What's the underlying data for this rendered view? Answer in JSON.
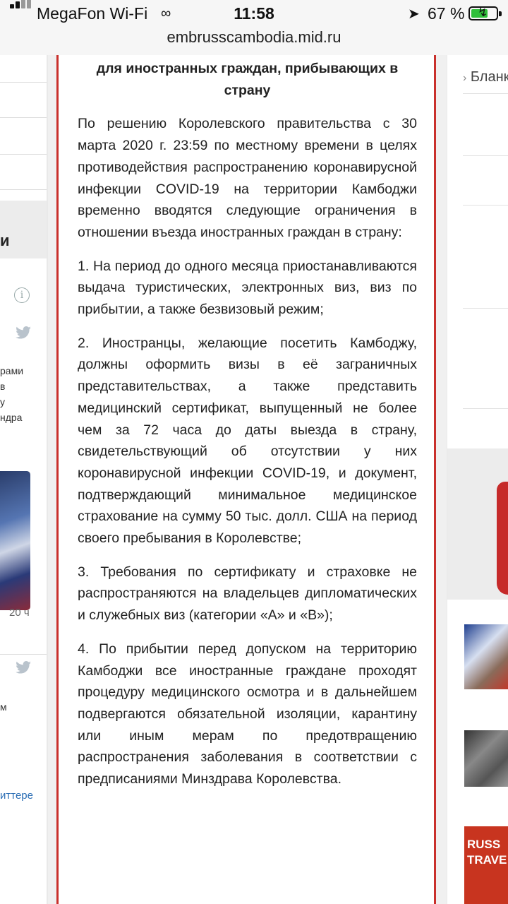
{
  "status_bar": {
    "carrier": "MegaFon Wi-Fi",
    "time": "11:58",
    "battery_percent": "67 %",
    "battery_level": 0.67,
    "battery_color": "#2fbf3a"
  },
  "browser": {
    "url": "embrusscambodia.mid.ru"
  },
  "article": {
    "heading": "для иностранных граждан, прибывающих в страну",
    "intro": "По решению Королевского правительства с 30 марта 2020 г. 23:59 по местному времени в целях противодействия распространению коронавирусной инфекции COVID-19 на территории Камбоджи временно вводятся следующие ограничения в отношении въезда иностранных граждан в страну:",
    "items": [
      "1. На период до одного месяца приостанавливаются выдача туристических, электронных виз, виз по прибытии, а также безвизовый режим;",
      "2. Иностранцы, желающие посетить Камбоджу, должны оформить визы в её заграничных представительствах, а также представить медицинский сертификат, выпущенный не более чем за 72 часа до даты выезда в страну, свидетельствующий об отсутствии у них коронавирусной инфекции COVID-19, и документ, подтверждающий минимальное медицинское страхование на сумму 50 тыс. долл. США на период своего пребывания в Королевстве;",
      "3. Требования по сертификату и страховке не распространяются на владельцев дипломатических и служебных виз (категории «А» и «В»);",
      "4. По прибытии перед допуском на территорию Камбоджи все иностранные граждане проходят процедуру медицинского осмотра и в дальнейшем подвергаются обязательной изоляции, карантину или иным мерам по предотвращению распространения заболевания в соответствии с предписаниями Минздрава Королевства."
    ]
  },
  "left_column": {
    "fragment_heading": "и",
    "tweet1_lines": [
      "рами",
      "в",
      "у",
      "ндра"
    ],
    "tweet1_time": "20 ч",
    "tweet2_lines": [
      "м"
    ],
    "twitter_link": "иттере"
  },
  "right_column": {
    "menu_item": "Бланк",
    "banner_text": [
      "RUSS",
      "TRAVE"
    ]
  },
  "colors": {
    "frame_border": "#c9302c",
    "twitter_blue": "#2b6eb5"
  }
}
